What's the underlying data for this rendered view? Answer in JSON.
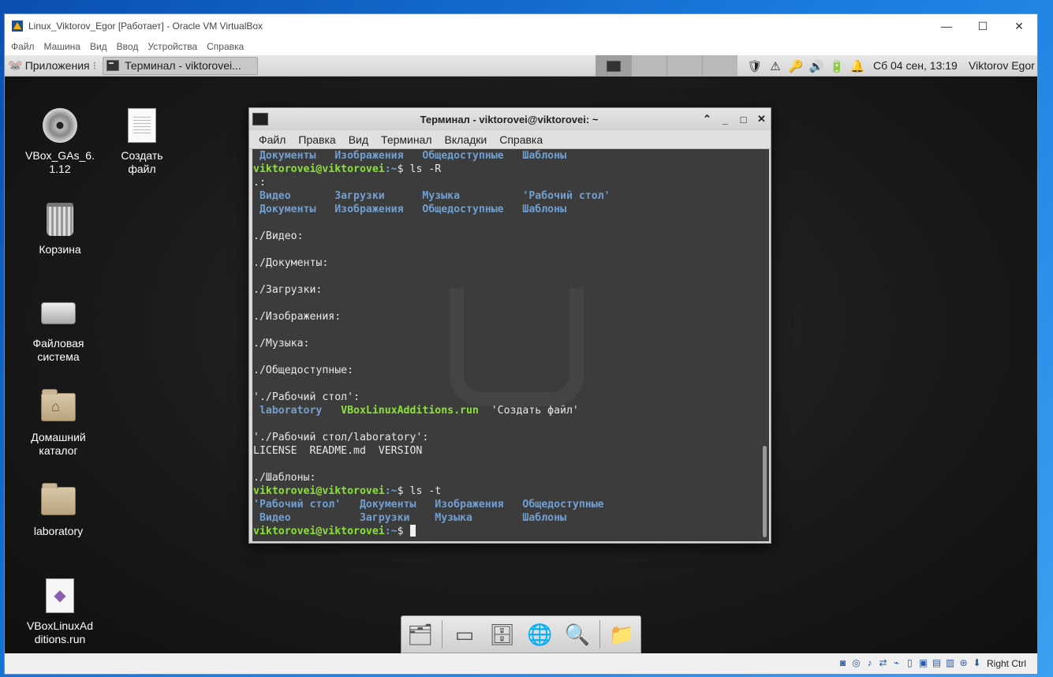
{
  "window": {
    "title": "Linux_Viktorov_Egor [Работает] - Oracle VM VirtualBox",
    "menu": [
      "Файл",
      "Машина",
      "Вид",
      "Ввод",
      "Устройства",
      "Справка"
    ],
    "controls": {
      "minimize": "—",
      "maximize": "☐",
      "close": "✕"
    }
  },
  "panel": {
    "apps_label": "Приложения",
    "task_label": "Терминал - viktorovei...",
    "clock": "Сб 04 сен, 13:19",
    "user": "Viktorov Egor"
  },
  "desktop_icons": [
    {
      "label": "VBox_GAs_6.\n1.12",
      "icon": "cdrom-icon"
    },
    {
      "label": "Создать\nфайл",
      "icon": "document-icon"
    },
    {
      "label": "Корзина",
      "icon": "trash-icon"
    },
    {
      "label": "Файловая\nсистема",
      "icon": "drive-icon"
    },
    {
      "label": "Домашний\nкаталог",
      "icon": "home-folder-icon"
    },
    {
      "label": "laboratory",
      "icon": "folder-icon"
    },
    {
      "label": "VBoxLinuxAd\nditions.run",
      "icon": "script-icon"
    }
  ],
  "terminal": {
    "title": "Терминал - viktorovei@viktorovei: ~",
    "controls": {
      "up": "⌃",
      "minimize": "_",
      "maximize": "□",
      "close": "✕"
    },
    "menu": [
      "Файл",
      "Правка",
      "Вид",
      "Терминал",
      "Вкладки",
      "Справка"
    ],
    "prompt_user": "viktorovei@viktorovei",
    "prompt_path": ":~",
    "prompt_end": "$ ",
    "lines": [
      {
        "t": "dirs",
        "cells": [
          " Документы",
          "   Изображения",
          "   Общедоступные",
          "   Шаблоны"
        ]
      },
      {
        "t": "prompt",
        "cmd": "ls -R"
      },
      {
        "t": "plain",
        "text": ".:"
      },
      {
        "t": "dirs",
        "cells": [
          " Видео",
          "       Загрузки",
          "      Музыка",
          "          'Рабочий стол'"
        ]
      },
      {
        "t": "dirs",
        "cells": [
          " Документы",
          "   Изображения",
          "   Общедоступные",
          "   Шаблоны"
        ]
      },
      {
        "t": "plain",
        "text": ""
      },
      {
        "t": "plain",
        "text": "./Видео:"
      },
      {
        "t": "plain",
        "text": ""
      },
      {
        "t": "plain",
        "text": "./Документы:"
      },
      {
        "t": "plain",
        "text": ""
      },
      {
        "t": "plain",
        "text": "./Загрузки:"
      },
      {
        "t": "plain",
        "text": ""
      },
      {
        "t": "plain",
        "text": "./Изображения:"
      },
      {
        "t": "plain",
        "text": ""
      },
      {
        "t": "plain",
        "text": "./Музыка:"
      },
      {
        "t": "plain",
        "text": ""
      },
      {
        "t": "plain",
        "text": "./Общедоступные:"
      },
      {
        "t": "plain",
        "text": ""
      },
      {
        "t": "plain",
        "text": "'./Рабочий стол':"
      },
      {
        "t": "mixed",
        "cells": [
          {
            "c": "dir",
            "v": " laboratory"
          },
          {
            "c": "exe",
            "v": "   VBoxLinuxAdditions.run"
          },
          {
            "c": "",
            "v": "  'Создать файл'"
          }
        ]
      },
      {
        "t": "plain",
        "text": ""
      },
      {
        "t": "plain",
        "text": "'./Рабочий стол/laboratory':"
      },
      {
        "t": "plain",
        "text": "LICENSE  README.md  VERSION"
      },
      {
        "t": "plain",
        "text": ""
      },
      {
        "t": "plain",
        "text": "./Шаблоны:"
      },
      {
        "t": "prompt",
        "cmd": "ls -t"
      },
      {
        "t": "dirs",
        "cells": [
          "'Рабочий стол'",
          "   Документы",
          "   Изображения",
          "   Общедоступные"
        ]
      },
      {
        "t": "dirs",
        "cells": [
          " Видео",
          "           Загрузки",
          "    Музыка",
          "        Шаблоны"
        ]
      },
      {
        "t": "prompt",
        "cmd": "",
        "cursor": true
      }
    ]
  },
  "dock": [
    "files-icon",
    "desktop-icon",
    "drawer-icon",
    "browser-icon",
    "search-icon",
    "folder-icon"
  ],
  "statusbar": {
    "hostkey": "Right Ctrl"
  }
}
